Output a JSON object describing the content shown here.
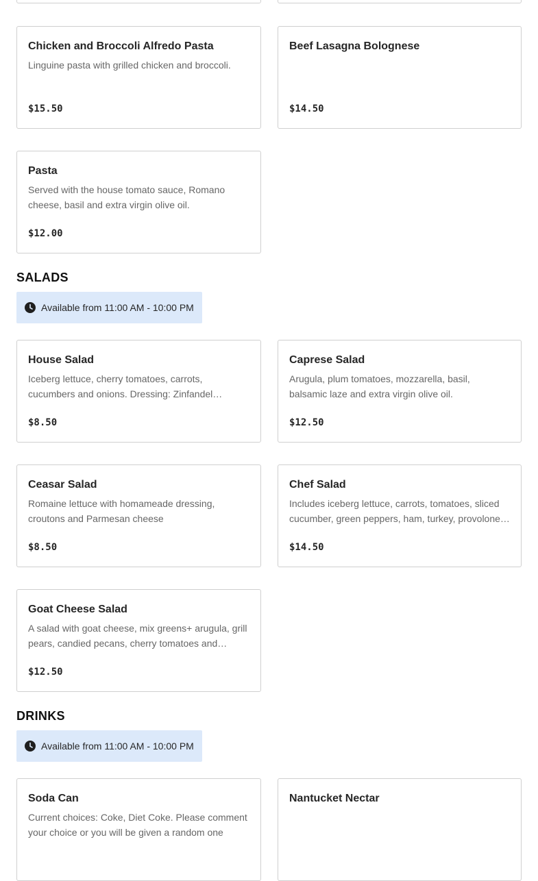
{
  "pasta_section": {
    "items": [
      {
        "name": "Chicken and Broccoli Alfredo Pasta",
        "description": "Linguine pasta with grilled chicken and broccoli.",
        "price": "$15.50"
      },
      {
        "name": "Beef Lasagna Bolognese",
        "description": "",
        "price": "$14.50"
      },
      {
        "name": "Pasta",
        "description": "Served with the house tomato sauce, Romano cheese, basil and extra virgin olive oil.",
        "price": "$12.00"
      }
    ]
  },
  "salads_section": {
    "title": "SALADS",
    "availability": "Available from 11:00 AM - 10:00 PM",
    "items": [
      {
        "name": "House Salad",
        "description": "Iceberg lettuce, cherry tomatoes, carrots, cucumbers and onions. Dressing: Zinfandel vinaigrette",
        "price": "$8.50"
      },
      {
        "name": "Caprese Salad",
        "description": "Arugula, plum tomatoes, mozzarella, basil, balsamic laze and extra virgin olive oil.",
        "price": "$12.50"
      },
      {
        "name": "Ceasar Salad",
        "description": "Romaine lettuce with homameade dressing, croutons and Parmesan cheese",
        "price": "$8.50"
      },
      {
        "name": "Chef Salad",
        "description": "Includes iceberg lettuce, carrots, tomatoes, sliced cucumber, green peppers, ham, turkey, provolone cheese",
        "price": "$14.50"
      },
      {
        "name": "Goat Cheese Salad",
        "description": "A salad with goat cheese, mix greens+ arugula, grill pears, candied pecans, cherry tomatoes and balsamic dressing",
        "price": "$12.50"
      }
    ]
  },
  "drinks_section": {
    "title": "DRINKS",
    "availability": "Available from 11:00 AM - 10:00 PM",
    "items": [
      {
        "name": "Soda Can",
        "description": "Current choices: Coke, Diet Coke. Please comment your choice or you will be given a random one",
        "price": ""
      },
      {
        "name": "Nantucket Nectar",
        "description": "",
        "price": ""
      }
    ]
  },
  "icons": {
    "availability_icon": "clock-icon"
  },
  "colors": {
    "availability_bg": "#dce9fa",
    "card_border": "#cfcfcf",
    "description_text": "#666666"
  }
}
